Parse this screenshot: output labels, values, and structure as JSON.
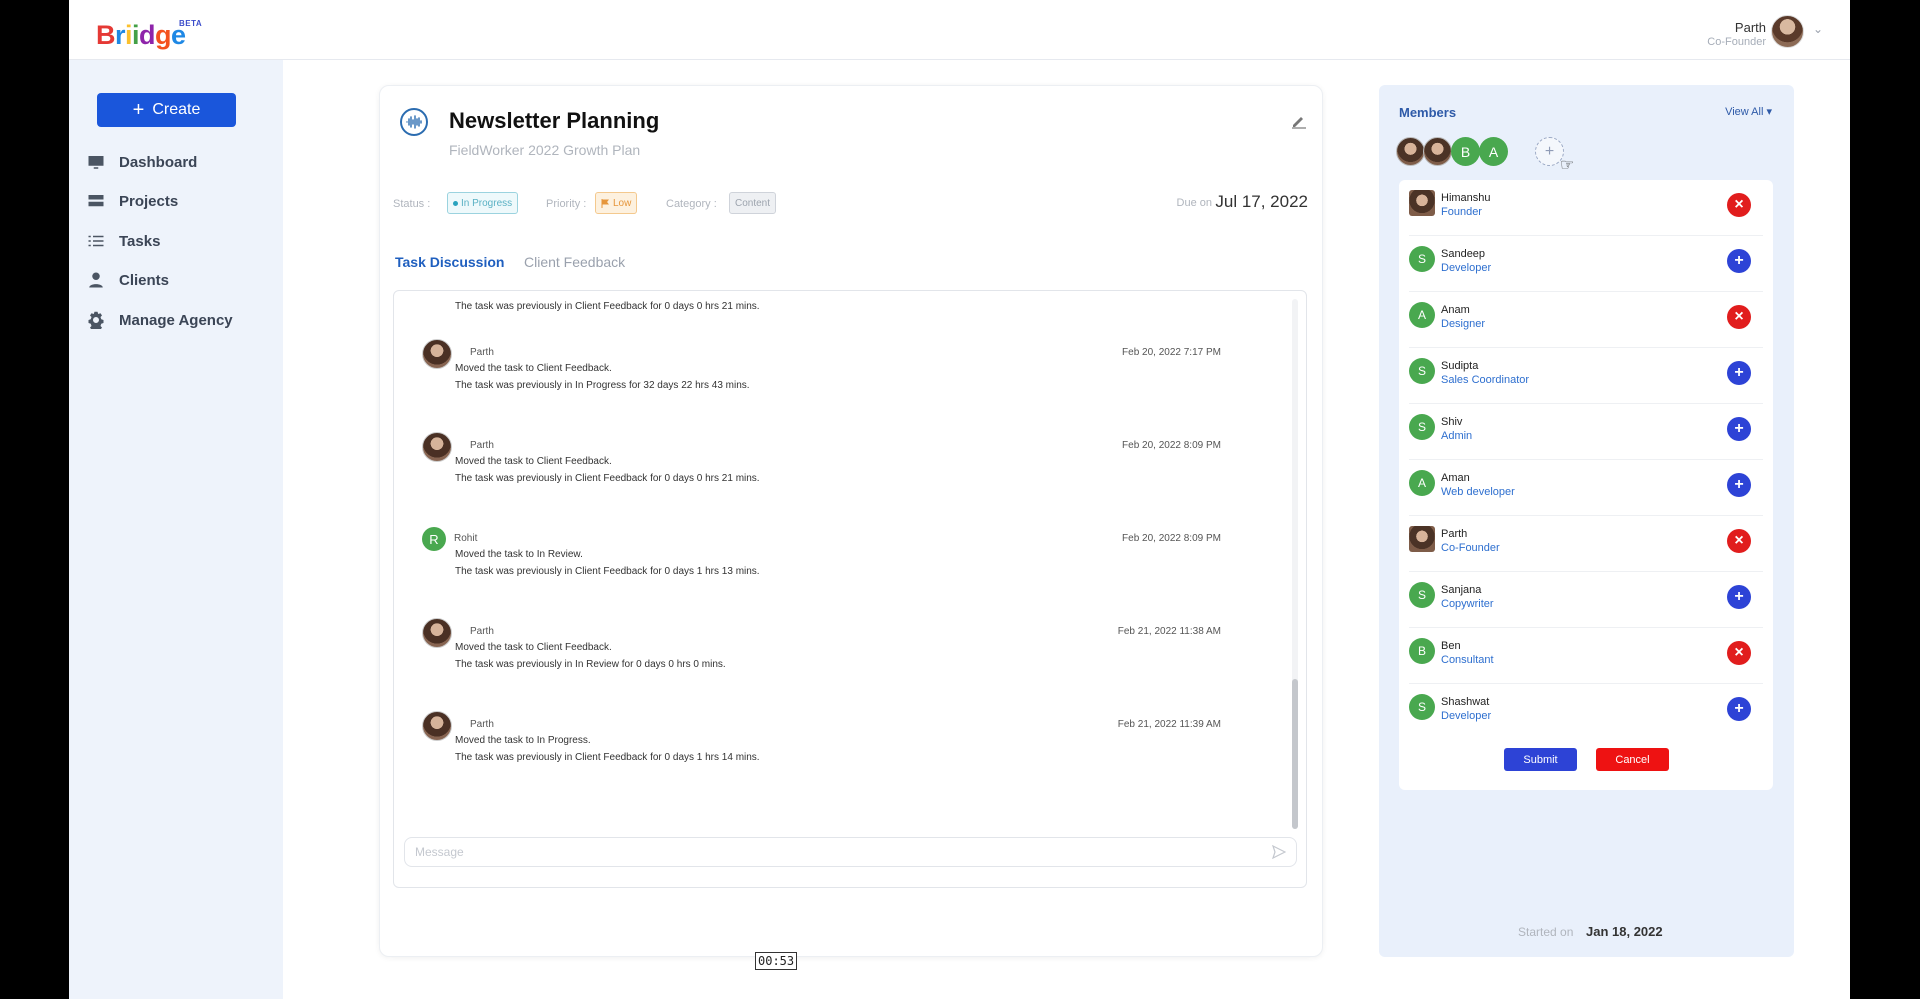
{
  "header": {
    "logo_text": [
      "B",
      "r",
      "i",
      "i",
      "d",
      "g",
      "e"
    ],
    "beta": "BETA",
    "user_name": "Parth",
    "user_role": "Co-Founder"
  },
  "sidebar": {
    "create_label": "Create",
    "items": [
      {
        "label": "Dashboard",
        "icon": "monitor-icon"
      },
      {
        "label": "Projects",
        "icon": "server-icon"
      },
      {
        "label": "Tasks",
        "icon": "checklist-icon"
      },
      {
        "label": "Clients",
        "icon": "person-icon"
      },
      {
        "label": "Manage Agency",
        "icon": "gear-icon"
      }
    ]
  },
  "task": {
    "title": "Newsletter Planning",
    "subtitle": "FieldWorker 2022 Growth Plan",
    "status_label": "Status :",
    "status": "In Progress",
    "priority_label": "Priority :",
    "priority": "Low",
    "category_label": "Category :",
    "category": "Content",
    "due_label": "Due on",
    "due_date": "Jul 17, 2022"
  },
  "tabs": [
    "Task Discussion",
    "Client Feedback"
  ],
  "discussion": {
    "first_line": "The task was previously in Client Feedback for 0 days 0 hrs 21 mins.",
    "messages": [
      {
        "author": "Parth",
        "time": "Feb 20, 2022 7:17 PM",
        "line1": "Moved the task to Client Feedback.",
        "line2": "The task was previously in In Progress for 32 days 22 hrs 43 mins."
      },
      {
        "author": "Parth",
        "time": "Feb 20, 2022 8:09 PM",
        "line1": "Moved the task to Client Feedback.",
        "line2": "The task was previously in Client Feedback for 0 days 0 hrs 21 mins."
      },
      {
        "author": "Rohit",
        "initial": "R",
        "time": "Feb 20, 2022 8:09 PM",
        "line1": "Moved the task to In Review.",
        "line2": "The task was previously in Client Feedback for 0 days 1 hrs 13 mins."
      },
      {
        "author": "Parth",
        "time": "Feb 21, 2022 11:38 AM",
        "line1": "Moved the task to Client Feedback.",
        "line2": "The task was previously in In Review for 0 days 0 hrs 0 mins."
      },
      {
        "author": "Parth",
        "time": "Feb 21, 2022 11:39 AM",
        "line1": "Moved the task to In Progress.",
        "line2": "The task was previously in Client Feedback for 0 days 1 hrs 14 mins."
      }
    ],
    "message_placeholder": "Message"
  },
  "members": {
    "title": "Members",
    "view_all": "View All",
    "top_avatars": [
      "B",
      "A"
    ],
    "list": [
      {
        "name": "Himanshu",
        "role": "Founder",
        "avatar": "photo",
        "action": "remove"
      },
      {
        "name": "Sandeep",
        "role": "Developer",
        "avatar": "S",
        "action": "add"
      },
      {
        "name": "Anam",
        "role": "Designer",
        "avatar": "A",
        "action": "remove"
      },
      {
        "name": "Sudipta",
        "role": "Sales Coordinator",
        "avatar": "S",
        "action": "add"
      },
      {
        "name": "Shiv",
        "role": "Admin",
        "avatar": "S",
        "action": "add"
      },
      {
        "name": "Aman",
        "role": "Web developer",
        "avatar": "A",
        "action": "add"
      },
      {
        "name": "Parth",
        "role": "Co-Founder",
        "avatar": "photo",
        "action": "remove"
      },
      {
        "name": "Sanjana",
        "role": "Copywriter",
        "avatar": "S",
        "action": "add"
      },
      {
        "name": "Ben",
        "role": "Consultant",
        "avatar": "B",
        "action": "remove"
      },
      {
        "name": "Shashwat",
        "role": "Developer",
        "avatar": "S",
        "action": "add"
      }
    ],
    "submit": "Submit",
    "cancel": "Cancel",
    "started_label": "Started on",
    "started_date": "Jan 18, 2022"
  },
  "timer": "00:53",
  "colors": {
    "accent": "#1a56db",
    "remove": "#e11d1d",
    "add": "#2d43d6",
    "avatar_green": "#49a84f"
  }
}
